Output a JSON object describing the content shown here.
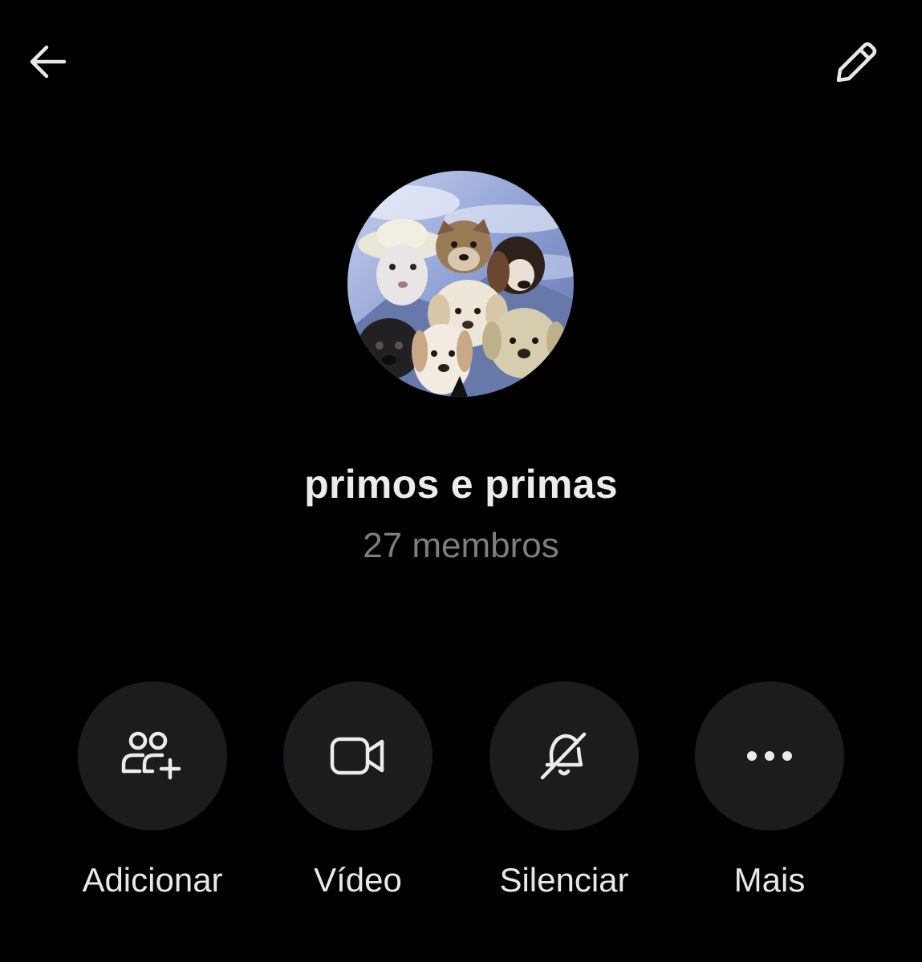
{
  "header": {
    "back_icon": "arrow-left-icon",
    "edit_icon": "pencil-icon"
  },
  "group": {
    "name": "primos e primas",
    "members": "27 membros",
    "avatar_description_icon": "group-avatar-puppies"
  },
  "actions": [
    {
      "label": "Adicionar",
      "icon": "add-people-icon"
    },
    {
      "label": "Vídeo",
      "icon": "video-camera-icon"
    },
    {
      "label": "Silenciar",
      "icon": "bell-off-icon"
    },
    {
      "label": "Mais",
      "icon": "more-dots-icon"
    }
  ],
  "colors": {
    "background": "#000000",
    "button_bg": "#1c1c1e",
    "text_primary": "#ececec",
    "text_secondary": "#7d7d82"
  }
}
